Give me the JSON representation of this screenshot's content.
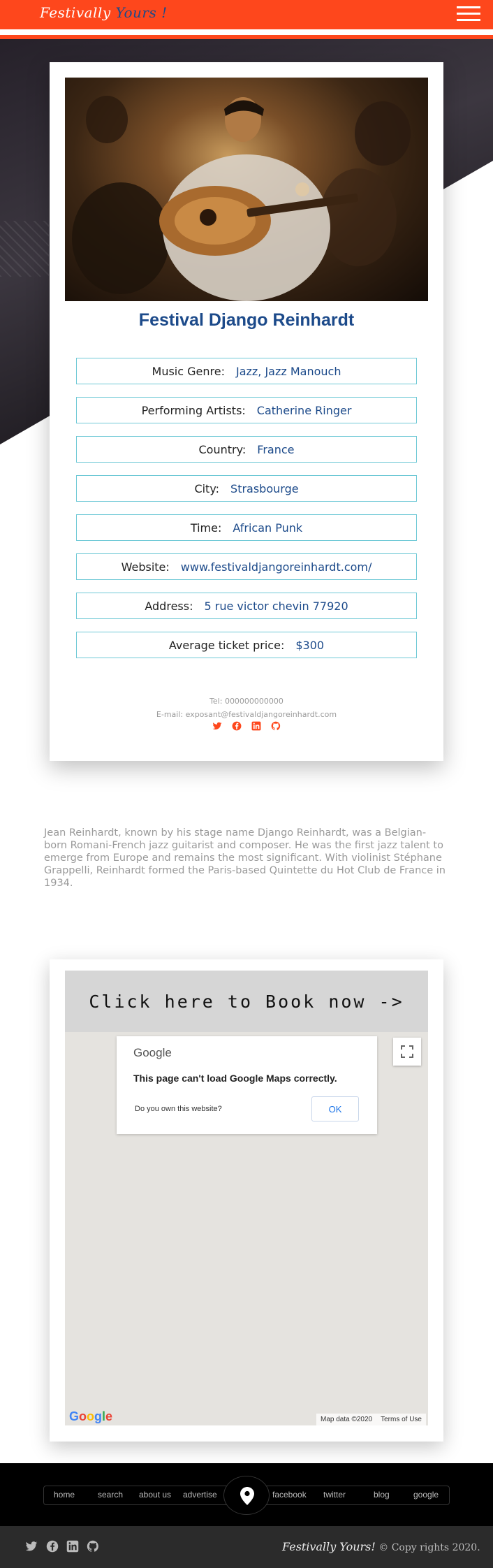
{
  "header": {
    "logo_part1": "Festivally",
    "logo_part2": "Yours !",
    "menu_icon": "hamburger-icon",
    "accent_color": "#fe471c",
    "brand_blue": "#1c4a8a"
  },
  "festival": {
    "title": "Festival Django Reinhardt",
    "image_alt": "Django Reinhardt playing guitar",
    "details": [
      {
        "label": "Music Genre:",
        "value": "Jazz, Jazz Manouch"
      },
      {
        "label": "Performing Artists:",
        "value": "Catherine Ringer"
      },
      {
        "label": "Country:",
        "value": "France"
      },
      {
        "label": "City:",
        "value": "Strasbourge"
      },
      {
        "label": "Time:",
        "value": "African Punk"
      },
      {
        "label": "Website:",
        "value": "www.festivaldjangoreinhardt.com/"
      },
      {
        "label": "Address:",
        "value": "5 rue victor chevin 77920"
      },
      {
        "label": "Average ticket price:",
        "value": "$300"
      }
    ],
    "tel": "Tel: 000000000000",
    "email": "E-mail: exposant@festivaldjangoreinhardt.com",
    "social_icons": [
      "twitter-icon",
      "facebook-icon",
      "linkedin-icon",
      "github-icon"
    ]
  },
  "bio": "Jean Reinhardt, known by his stage name Django Reinhardt, was a Belgian-born Romani-French jazz guitarist and composer. He was the first jazz talent to emerge from Europe and remains the most significant. With violinist Stéphane Grappelli, Reinhardt formed the Paris-based Quintette du Hot Club de France in 1934.",
  "booking": {
    "cta": "Click here to Book now ->",
    "map_brand": "Google",
    "error_message": "This page can't load Google Maps correctly.",
    "owner_question": "Do you own this website?",
    "ok_label": "OK",
    "map_data": "Map data ©2020",
    "terms": "Terms of Use"
  },
  "footer": {
    "nav": [
      "home",
      "search",
      "about us",
      "advertise",
      "facebook",
      "twitter",
      "blog",
      "google"
    ],
    "pin_icon": "location-pin-icon",
    "brand": "Festivally Yours!",
    "copyright": " © Copy rights 2020."
  }
}
